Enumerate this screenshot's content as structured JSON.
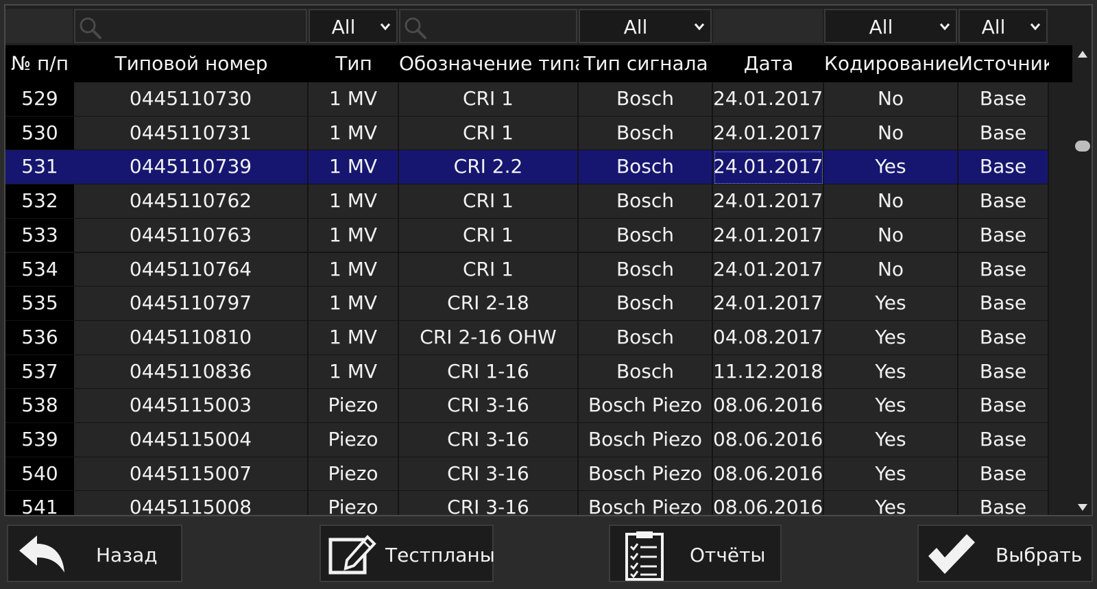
{
  "filters": {
    "search1": {
      "value": "",
      "placeholder": ""
    },
    "type_select": "All",
    "search2": {
      "value": "",
      "placeholder": ""
    },
    "signal_select": "All",
    "coding_select": "All",
    "source_select": "All"
  },
  "columns": [
    "№ п/п",
    "Типовой номер",
    "Тип",
    "Обозначение типа",
    "Тип сигнала",
    "Дата",
    "Кодирование",
    "Источник"
  ],
  "rows": [
    [
      "529",
      "0445110730",
      "1 MV",
      "CRI 1",
      "Bosch",
      "24.01.2017",
      "No",
      "Base"
    ],
    [
      "530",
      "0445110731",
      "1 MV",
      "CRI 1",
      "Bosch",
      "24.01.2017",
      "No",
      "Base"
    ],
    [
      "531",
      "0445110739",
      "1 MV",
      "CRI 2.2",
      "Bosch",
      "24.01.2017",
      "Yes",
      "Base"
    ],
    [
      "532",
      "0445110762",
      "1 MV",
      "CRI 1",
      "Bosch",
      "24.01.2017",
      "No",
      "Base"
    ],
    [
      "533",
      "0445110763",
      "1 MV",
      "CRI 1",
      "Bosch",
      "24.01.2017",
      "No",
      "Base"
    ],
    [
      "534",
      "0445110764",
      "1 MV",
      "CRI 1",
      "Bosch",
      "24.01.2017",
      "No",
      "Base"
    ],
    [
      "535",
      "0445110797",
      "1 MV",
      "CRI 2-18",
      "Bosch",
      "24.01.2017",
      "Yes",
      "Base"
    ],
    [
      "536",
      "0445110810",
      "1 MV",
      "CRI 2-16 OHW",
      "Bosch",
      "04.08.2017",
      "Yes",
      "Base"
    ],
    [
      "537",
      "0445110836",
      "1 MV",
      "CRI 1-16",
      "Bosch",
      "11.12.2018",
      "Yes",
      "Base"
    ],
    [
      "538",
      "0445115003",
      "Piezo",
      "CRI 3-16",
      "Bosch Piezo",
      "08.06.2016",
      "Yes",
      "Base"
    ],
    [
      "539",
      "0445115004",
      "Piezo",
      "CRI 3-16",
      "Bosch Piezo",
      "08.06.2016",
      "Yes",
      "Base"
    ],
    [
      "540",
      "0445115007",
      "Piezo",
      "CRI 3-16",
      "Bosch Piezo",
      "08.06.2016",
      "Yes",
      "Base"
    ],
    [
      "541",
      "0445115008",
      "Piezo",
      "CRI 3-16",
      "Bosch Piezo",
      "08.06.2016",
      "Yes",
      "Base"
    ]
  ],
  "selected_row": 2,
  "scroll_position": 0.18,
  "buttons": {
    "back": "Назад",
    "testplans": "Тестпланы",
    "reports": "Отчёты",
    "select": "Выбрать"
  },
  "colors": {
    "selection": "#161670",
    "cell_bg": "#262626",
    "index_bg": "#000000"
  },
  "icons": {
    "back": "undo-arrow-icon",
    "testplans": "edit-document-icon",
    "reports": "checklist-clipboard-icon",
    "select": "checkmark-icon"
  }
}
